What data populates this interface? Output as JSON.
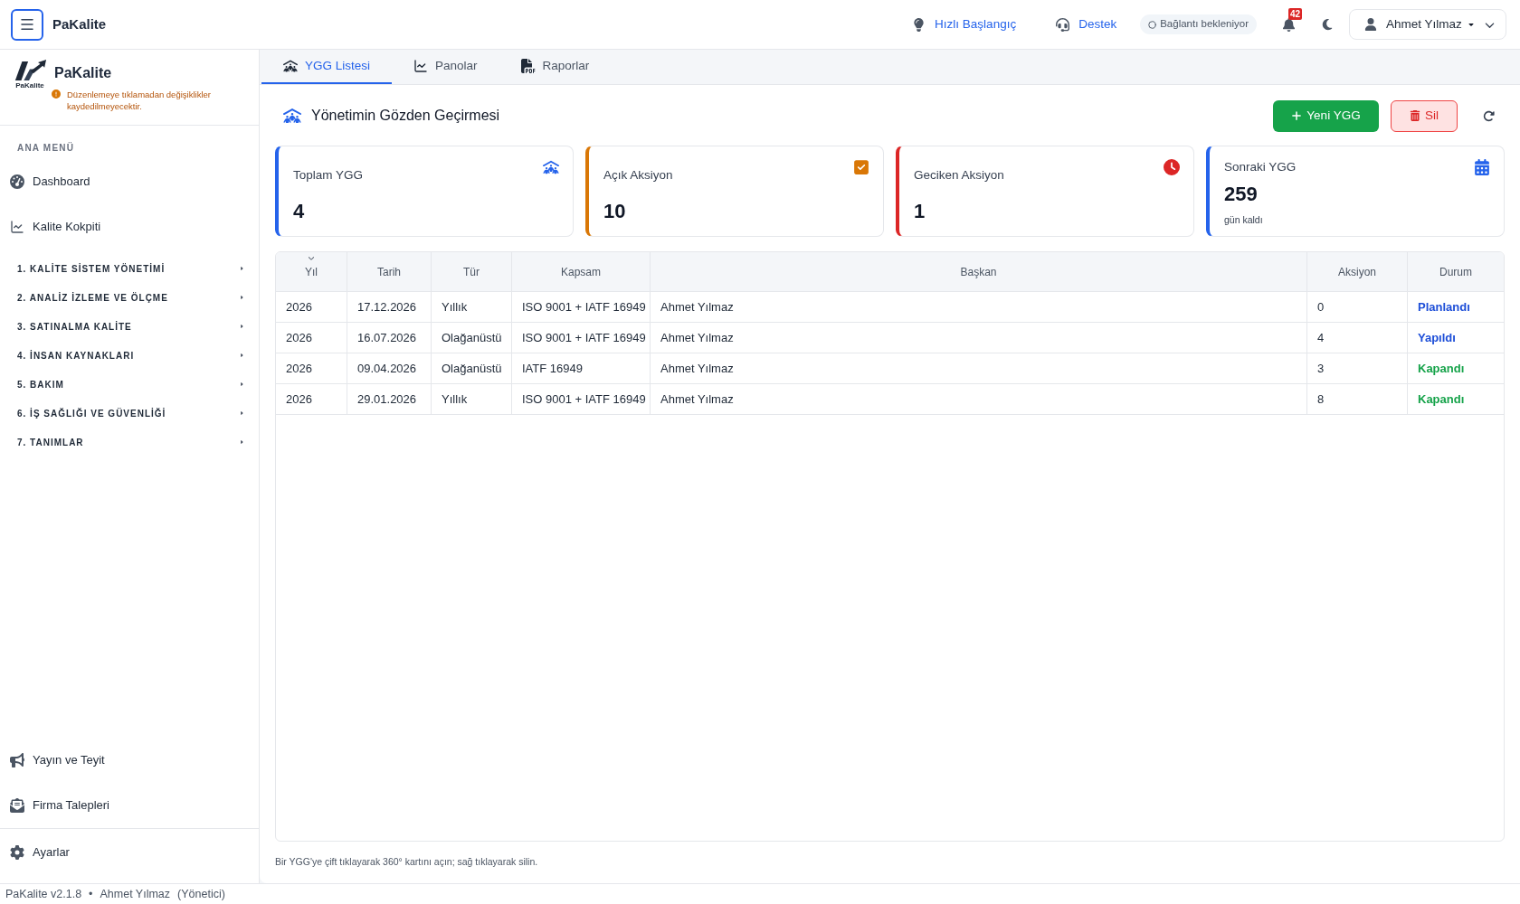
{
  "topbar": {
    "app_title": "PaKalite",
    "links": [
      {
        "label": "Hızlı Başlangıç"
      },
      {
        "label": "Destek"
      }
    ],
    "connection_status": "Bağlantı bekleniyor",
    "notifications_count": "42",
    "user": "Ahmet Yılmaz"
  },
  "sidebar": {
    "logo_text": "PaKalite",
    "title": "PaKalite",
    "warning": "Düzenlemeye tıklamadan değişiklikler kaydedilmeyecektir.",
    "menu_heading": "ANA MENÜ",
    "items": [
      {
        "label": "Dashboard"
      },
      {
        "label": "Kalite Kokpiti"
      }
    ],
    "sections": [
      {
        "label": "1. KALİTE SİSTEM YÖNETİMİ",
        "expanded": false
      },
      {
        "label": "2. ANALİZ İZLEME VE ÖLÇME",
        "expanded": false
      },
      {
        "label": "3. SATINALMA KALİTE",
        "expanded": false
      },
      {
        "label": "4. İNSAN KAYNAKLARI",
        "expanded": false
      },
      {
        "label": "5. BAKIM",
        "expanded": false
      },
      {
        "label": "6. İŞ SAĞLIĞI VE GÜVENLİĞİ",
        "expanded": false
      },
      {
        "label": "7. TANIMLAR",
        "expanded": false
      }
    ],
    "bottom_items": [
      {
        "label": "Yayın ve Teyit"
      },
      {
        "label": "Firma Talepleri"
      },
      {
        "label": "Ayarlar"
      }
    ]
  },
  "tabs": [
    {
      "label": "YGG Listesi",
      "selected": true
    },
    {
      "label": "Panolar",
      "selected": false
    },
    {
      "label": "Raporlar",
      "selected": false
    }
  ],
  "page": {
    "title": "Yönetimin Gözden Geçirmesi",
    "buttons": [
      {
        "label": "Yeni YGG",
        "kind": "primary"
      },
      {
        "label": "Sil",
        "kind": "danger"
      }
    ]
  },
  "stats": [
    {
      "label": "Toplam YGG",
      "value": "4",
      "color": "#2563eb"
    },
    {
      "label": "Açık Aksiyon",
      "value": "10",
      "color": "#d97706"
    },
    {
      "label": "Geciken Aksiyon",
      "value": "1",
      "color": "#dc2626"
    },
    {
      "label": "Sonraki YGG",
      "value": "259",
      "note": "gün kaldı",
      "color": "#2563eb"
    }
  ],
  "table": {
    "columns": [
      {
        "label": "Yıl",
        "sorted": true
      },
      {
        "label": "Tarih",
        "sorted": false
      },
      {
        "label": "Tür",
        "sorted": false
      },
      {
        "label": "Kapsam",
        "sorted": false
      },
      {
        "label": "Başkan",
        "sorted": false
      },
      {
        "label": "Aksiyon",
        "sorted": false
      },
      {
        "label": "Durum",
        "sorted": false
      }
    ],
    "rows": [
      {
        "year": "2026",
        "date": "17.12.2026",
        "type": "Yıllık",
        "scope": "ISO 9001 + IATF 16949",
        "chair": "Ahmet Yılmaz",
        "actions": "0",
        "status": "Planlandı",
        "color": "#1d4ed8"
      },
      {
        "year": "2026",
        "date": "16.07.2026",
        "type": "Olağanüstü",
        "scope": "ISO 9001 + IATF 16949",
        "chair": "Ahmet Yılmaz",
        "actions": "4",
        "status": "Yapıldı",
        "color": "#1d4ed8"
      },
      {
        "year": "2026",
        "date": "09.04.2026",
        "type": "Olağanüstü",
        "scope": "IATF 16949",
        "chair": "Ahmet Yılmaz",
        "actions": "3",
        "status": "Kapandı",
        "color": "#16a34a"
      },
      {
        "year": "2026",
        "date": "29.01.2026",
        "type": "Yıllık",
        "scope": "ISO 9001 + IATF 16949",
        "chair": "Ahmet Yılmaz",
        "actions": "8",
        "status": "Kapandı",
        "color": "#16a34a"
      }
    ]
  },
  "hint": "Bir YGG'ye çift tıklayarak 360° kartını açın; sağ tıklayarak silin.",
  "status_bar": {
    "version": "PaKalite v2.1.8",
    "separator": "•",
    "user": "Ahmet Yılmaz",
    "role": "(Yönetici)"
  }
}
